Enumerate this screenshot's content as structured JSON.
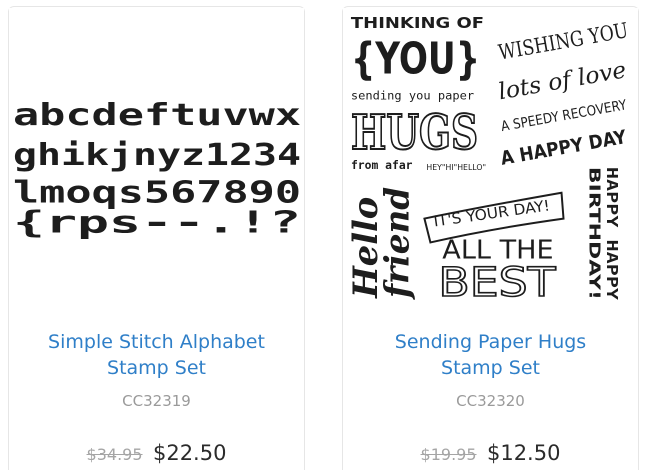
{
  "products": [
    {
      "title_line1": "Simple Stitch Alphabet",
      "title_line2": "Stamp Set",
      "sku": "CC32319",
      "old_price": "$34.95",
      "new_price": "$22.50",
      "image": {
        "row1": "abcdeftuvwx",
        "row2": "ghikjnyz1234",
        "row3": "lmoqs567890",
        "row4": "{rps--.!?"
      }
    },
    {
      "title_line1": "Sending Paper Hugs",
      "title_line2": "Stamp Set",
      "sku": "CC32320",
      "old_price": "$19.95",
      "new_price": "$12.50",
      "image": {
        "t1": "THINKING OF",
        "t2": "{YOU}",
        "t3": "sending you paper",
        "t4": "HUGS",
        "t5": "from afar",
        "t6": "HEY\"HI\"HELLO\"",
        "t7": "WISHING YOU",
        "t8": "lots of love",
        "t9": "A SPEEDY RECOVERY",
        "t10": "A HAPPY DAY",
        "t11": "IT'S YOUR DAY!",
        "t12": "ALL THE",
        "t13": "BEST",
        "t14": "Hello",
        "t15": "friend",
        "t16": "HAPPY HAPPY",
        "t17": "BIRTHDAY!"
      }
    }
  ]
}
